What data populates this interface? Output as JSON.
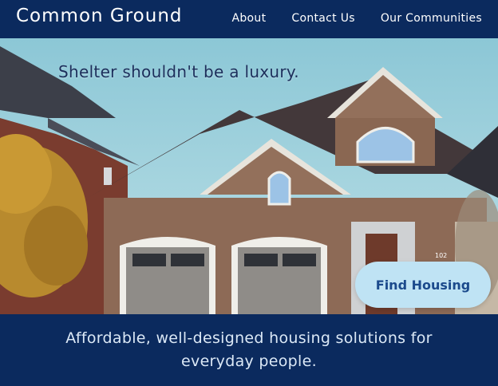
{
  "header": {
    "brand": "Common Ground",
    "nav": [
      {
        "label": "About"
      },
      {
        "label": "Contact Us"
      },
      {
        "label": "Our Communities"
      }
    ]
  },
  "hero": {
    "tagline": "Shelter shouldn't be a luxury.",
    "cta_label": "Find Housing",
    "house_number": "102"
  },
  "footer": {
    "subtitle": "Affordable, well-designed housing solutions for everyday people."
  },
  "colors": {
    "navy": "#0b2a5e",
    "cta_bg": "#bfe3f4",
    "cta_text": "#1b4a8c"
  }
}
